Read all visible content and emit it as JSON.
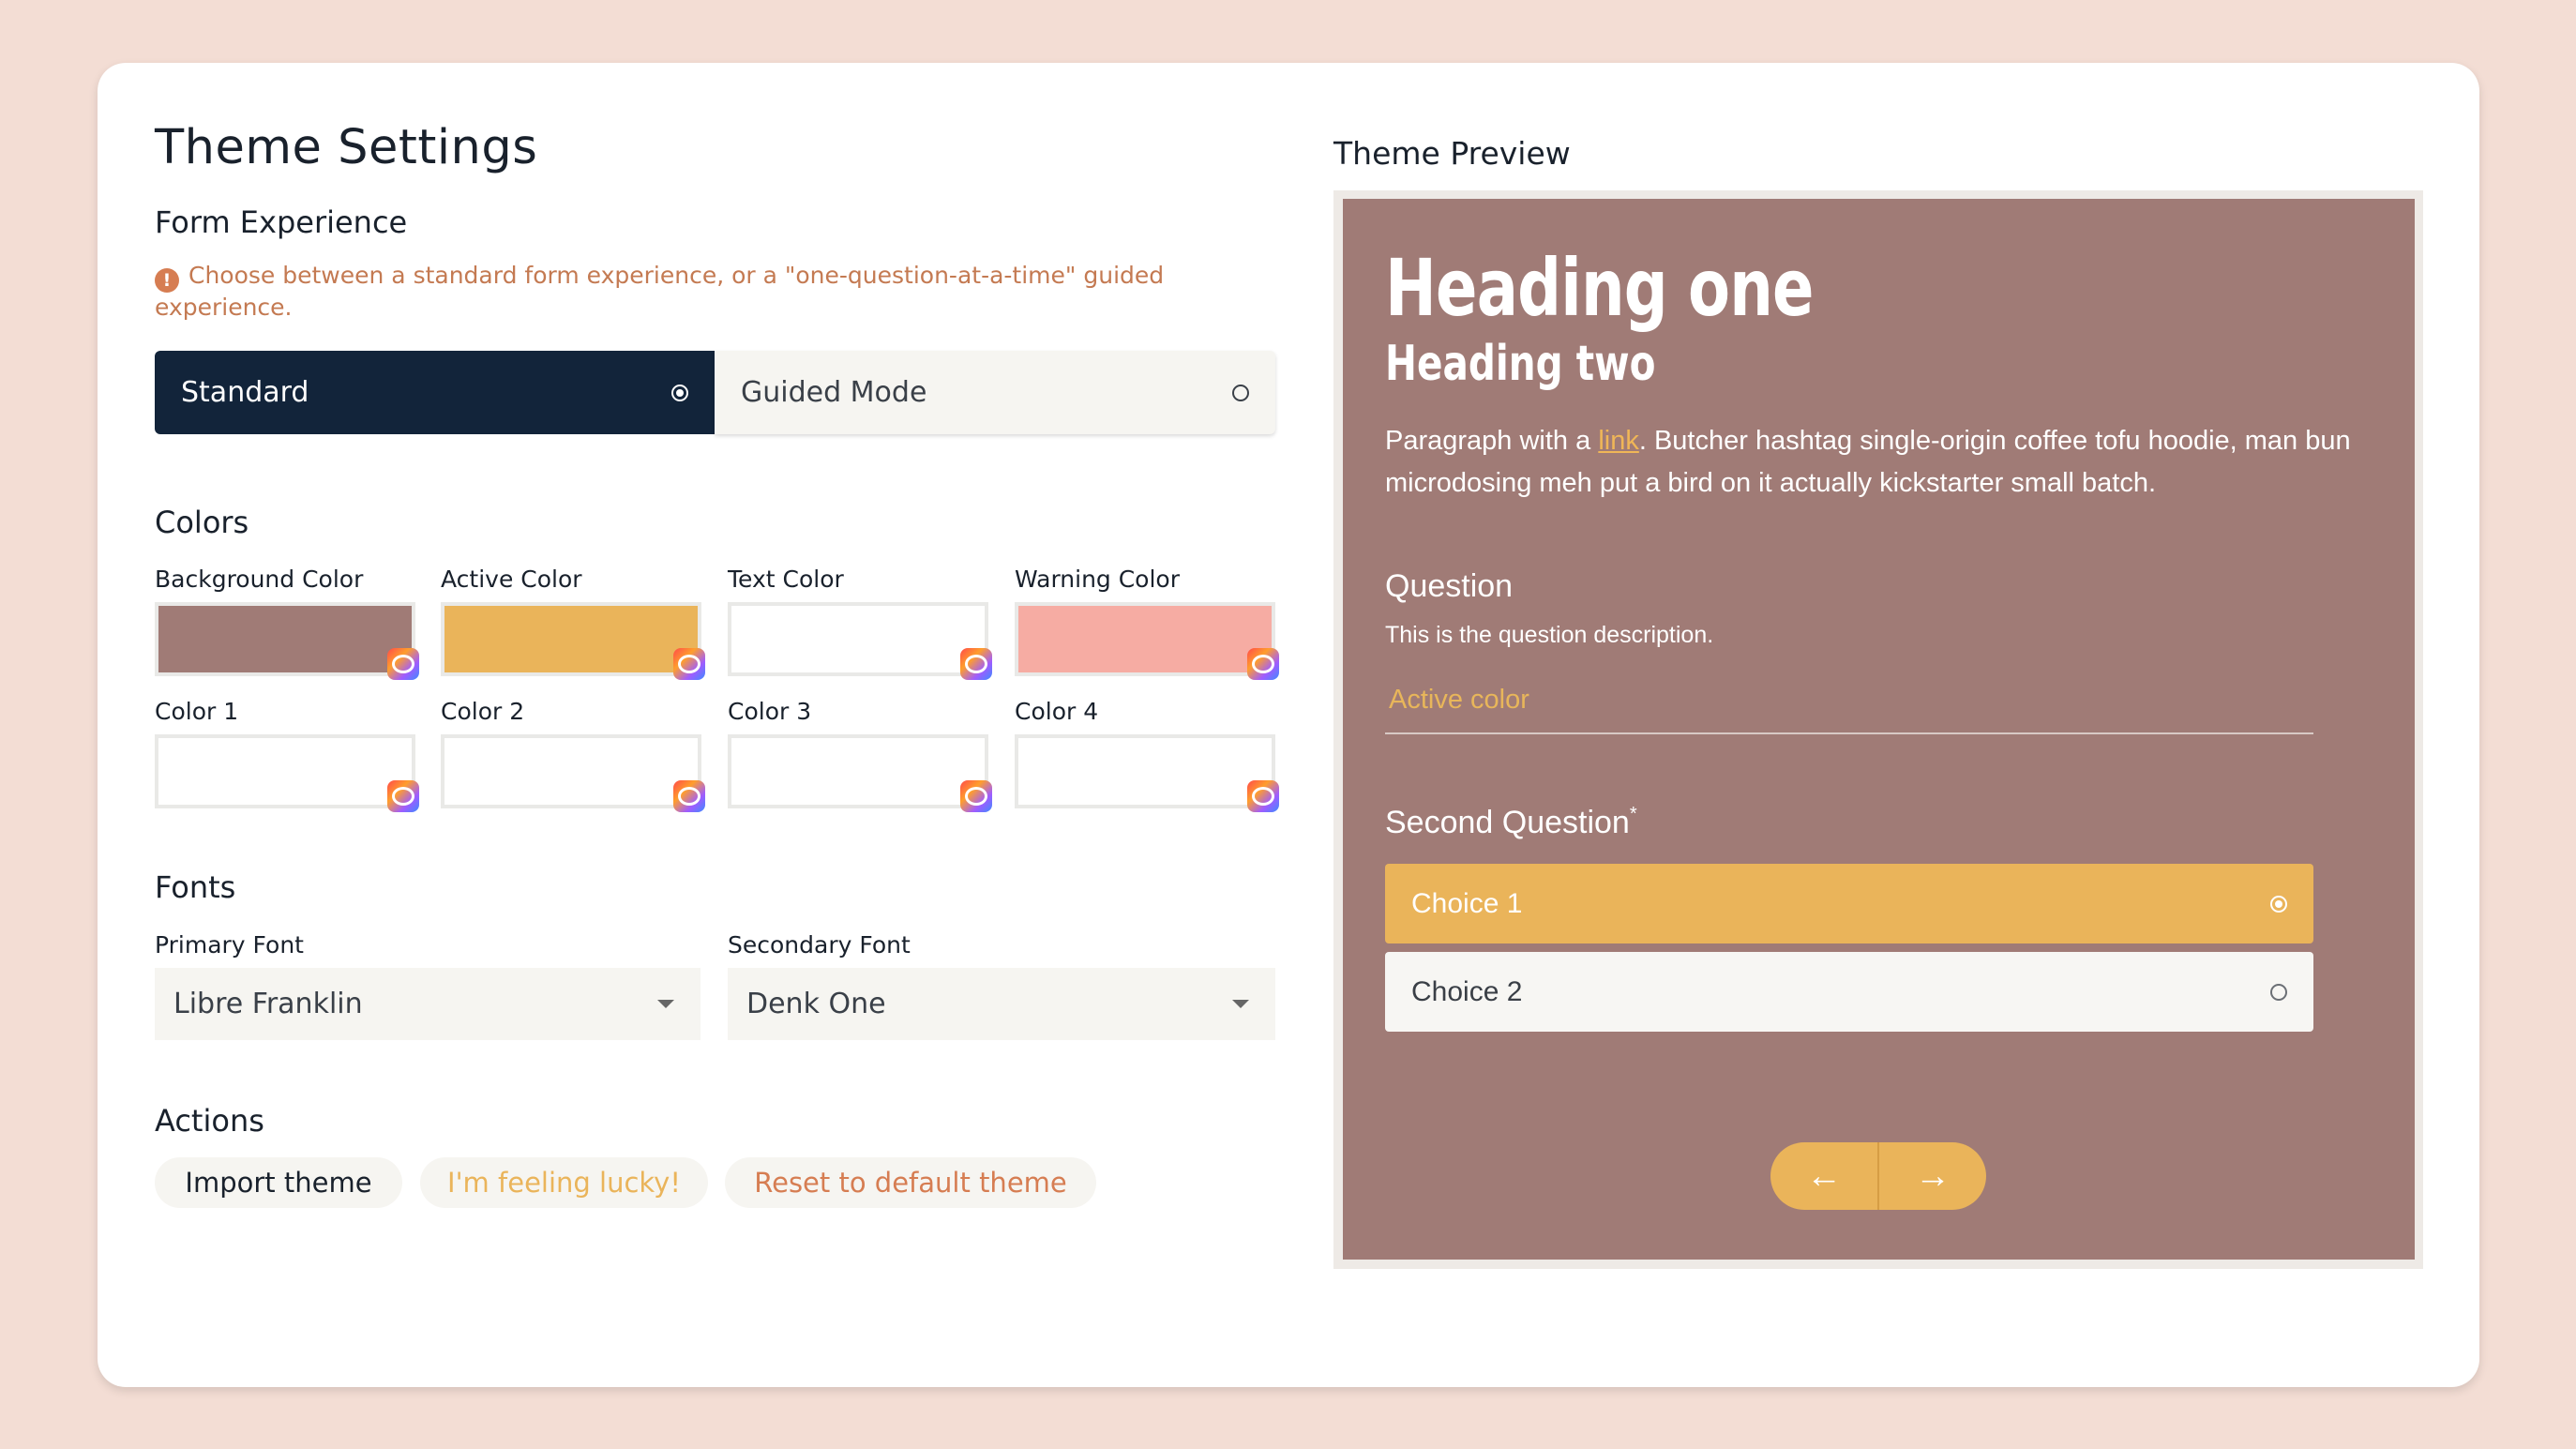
{
  "page": {
    "title": "Theme Settings"
  },
  "form_experience": {
    "heading": "Form Experience",
    "hint": "Choose between a standard form experience, or a \"one-question-at-a-time\" guided experience.",
    "options": [
      {
        "label": "Standard",
        "selected": true
      },
      {
        "label": "Guided Mode",
        "selected": false
      }
    ]
  },
  "colors": {
    "heading": "Colors",
    "items": [
      {
        "label": "Background Color",
        "value": "#a07b76"
      },
      {
        "label": "Active Color",
        "value": "#eab45a"
      },
      {
        "label": "Text Color",
        "value": "#ffffff"
      },
      {
        "label": "Warning Color",
        "value": "#f6aca3"
      },
      {
        "label": "Color 1",
        "value": "#ffffff"
      },
      {
        "label": "Color 2",
        "value": "#ffffff"
      },
      {
        "label": "Color 3",
        "value": "#ffffff"
      },
      {
        "label": "Color 4",
        "value": "#ffffff"
      }
    ]
  },
  "fonts": {
    "heading": "Fonts",
    "primary": {
      "label": "Primary Font",
      "value": "Libre Franklin"
    },
    "secondary": {
      "label": "Secondary Font",
      "value": "Denk One"
    }
  },
  "actions": {
    "heading": "Actions",
    "import": "Import theme",
    "lucky": "I'm feeling lucky!",
    "reset": "Reset to default theme"
  },
  "preview": {
    "title": "Theme Preview",
    "heading_one": "Heading one",
    "heading_two": "Heading two",
    "para_prefix": "Paragraph with a ",
    "para_link": "link",
    "para_suffix": ". Butcher hashtag single-origin coffee tofu hoodie, man bun microdosing meh put a bird on it actually kickstarter small batch.",
    "question": "Question",
    "question_desc": "This is the question description.",
    "answer": "Active color",
    "second_question": "Second Question",
    "required_mark": "*",
    "choices": [
      {
        "label": "Choice 1",
        "selected": true
      },
      {
        "label": "Choice 2",
        "selected": false
      }
    ],
    "prev_icon": "arrow-left-icon",
    "next_icon": "arrow-right-icon"
  }
}
